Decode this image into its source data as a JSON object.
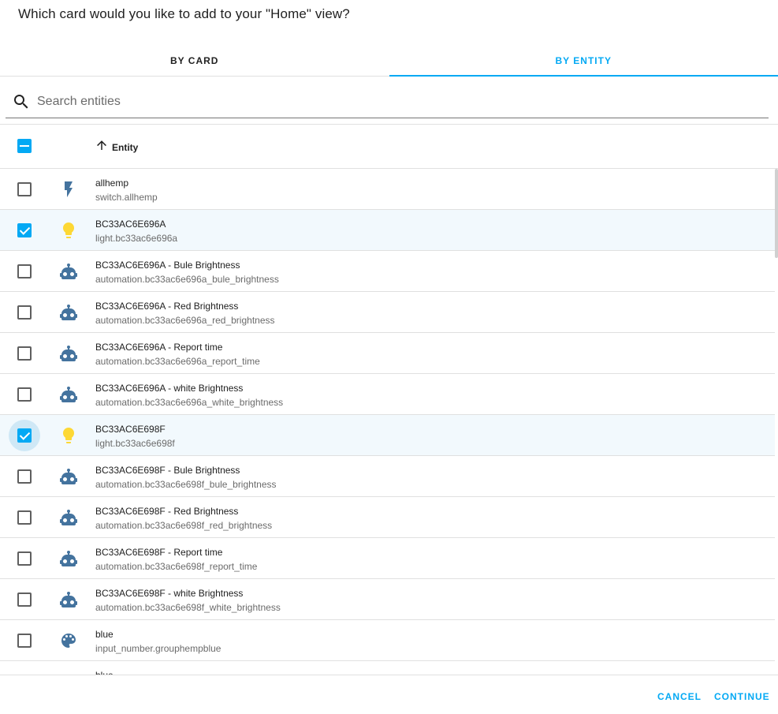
{
  "dialog": {
    "title": "Which card would you like to add to your \"Home\" view?"
  },
  "tabs": [
    {
      "label": "BY CARD",
      "active": false
    },
    {
      "label": "BY ENTITY",
      "active": true
    }
  ],
  "search": {
    "placeholder": "Search entities",
    "value": "",
    "icon": "magnify-icon"
  },
  "table": {
    "column_entity": "Entity",
    "sort_icon": "arrow-up-icon",
    "select_all_state": "indeterminate"
  },
  "colors": {
    "accent": "#03a9f4",
    "icon": "#44739e",
    "light_on": "#fdd835",
    "selected_row": "#f2f9fd"
  },
  "rows": [
    {
      "name": "allhemp",
      "entity_id": "switch.allhemp",
      "icon": "flash-icon",
      "checked": false
    },
    {
      "name": "BC33AC6E696A",
      "entity_id": "light.bc33ac6e696a",
      "icon": "lightbulb-icon",
      "checked": true
    },
    {
      "name": "BC33AC6E696A - Bule Brightness",
      "entity_id": "automation.bc33ac6e696a_bule_brightness",
      "icon": "robot-icon",
      "checked": false
    },
    {
      "name": "BC33AC6E696A - Red Brightness",
      "entity_id": "automation.bc33ac6e696a_red_brightness",
      "icon": "robot-icon",
      "checked": false
    },
    {
      "name": "BC33AC6E696A - Report time",
      "entity_id": "automation.bc33ac6e696a_report_time",
      "icon": "robot-icon",
      "checked": false
    },
    {
      "name": "BC33AC6E696A - white Brightness",
      "entity_id": "automation.bc33ac6e696a_white_brightness",
      "icon": "robot-icon",
      "checked": false
    },
    {
      "name": "BC33AC6E698F",
      "entity_id": "light.bc33ac6e698f",
      "icon": "lightbulb-icon",
      "checked": true,
      "focused": true
    },
    {
      "name": "BC33AC6E698F - Bule Brightness",
      "entity_id": "automation.bc33ac6e698f_bule_brightness",
      "icon": "robot-icon",
      "checked": false
    },
    {
      "name": "BC33AC6E698F - Red Brightness",
      "entity_id": "automation.bc33ac6e698f_red_brightness",
      "icon": "robot-icon",
      "checked": false
    },
    {
      "name": "BC33AC6E698F - Report time",
      "entity_id": "automation.bc33ac6e698f_report_time",
      "icon": "robot-icon",
      "checked": false
    },
    {
      "name": "BC33AC6E698F - white Brightness",
      "entity_id": "automation.bc33ac6e698f_white_brightness",
      "icon": "robot-icon",
      "checked": false
    },
    {
      "name": "blue",
      "entity_id": "input_number.grouphempblue",
      "icon": "palette-icon",
      "checked": false
    },
    {
      "name": "blue",
      "entity_id": "",
      "icon": "palette-icon",
      "checked": false
    }
  ],
  "footer": {
    "cancel_label": "CANCEL",
    "continue_label": "CONTINUE"
  }
}
